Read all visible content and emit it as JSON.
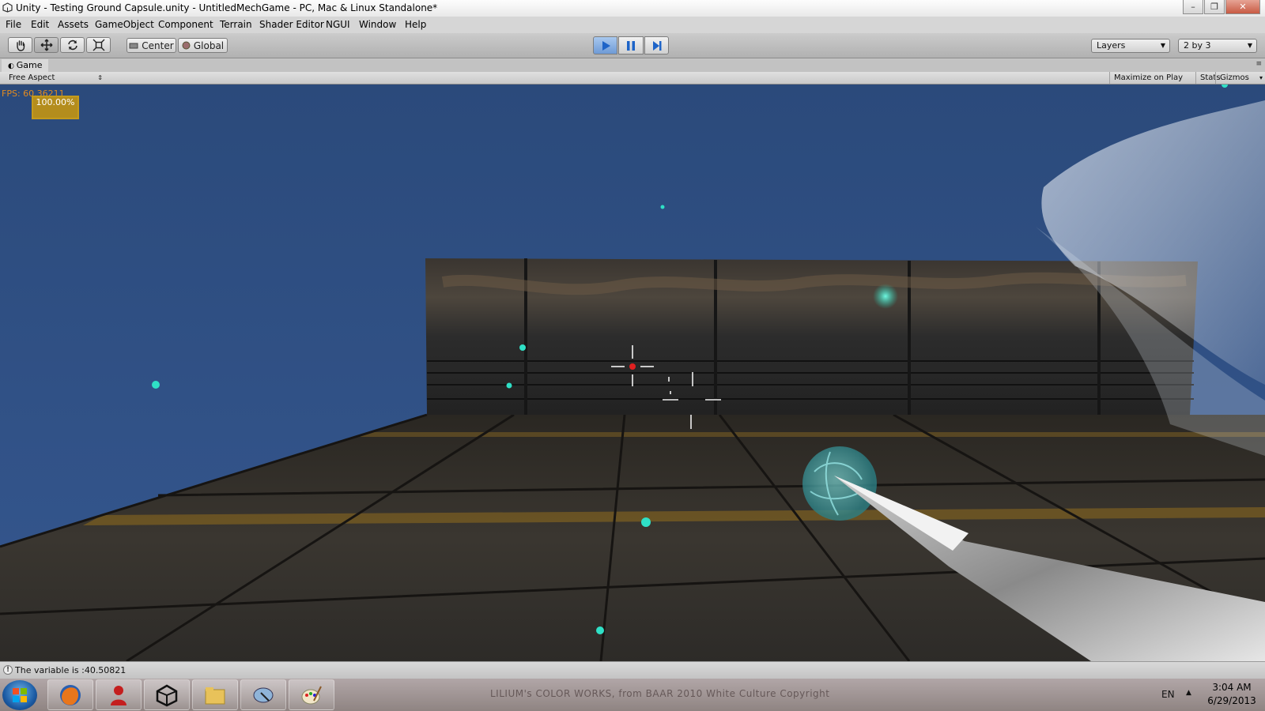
{
  "window": {
    "title": "Unity - Testing Ground Capsule.unity - UntitledMechGame - PC, Mac & Linux Standalone*",
    "controls": [
      "–",
      "❐",
      "✕"
    ]
  },
  "menu": [
    "File",
    "Edit",
    "Assets",
    "GameObject",
    "Component",
    "Terrain",
    "Shader Editor",
    "NGUI",
    "Window",
    "Help"
  ],
  "toolbar": {
    "tools": [
      "hand-icon",
      "move-icon",
      "rotate-icon",
      "scale-icon"
    ],
    "pivot_label": "Center",
    "space_label": "Global",
    "play_state": "playing",
    "layers_label": "Layers",
    "layout_label": "2 by 3"
  },
  "game_view": {
    "tab_label": "Game",
    "aspect_label": "Free Aspect",
    "maximize_label": "Maximize on Play",
    "stats_label": "Stats",
    "gizmos_label": "Gizmos",
    "fps_text": "FPS: 60.36211",
    "health_text": "100.00%"
  },
  "status": {
    "message": "The variable is :40.50821"
  },
  "taskbar": {
    "apps": [
      "firefox-icon",
      "person-app-icon",
      "unity-icon",
      "file-explorer-icon",
      "app-icon",
      "paint-icon"
    ],
    "wallpaper_text": "LILIUM's COLOR WORKS, from BAAR 2010 White Culture Copyright",
    "language": "EN",
    "time": "3:04 AM",
    "date": "6/29/2013"
  },
  "colors": {
    "sky": "#2e4c7d",
    "accent_play": "#6e9ad6",
    "fps_text": "#e08a20",
    "orb": "#2ee6c8"
  }
}
